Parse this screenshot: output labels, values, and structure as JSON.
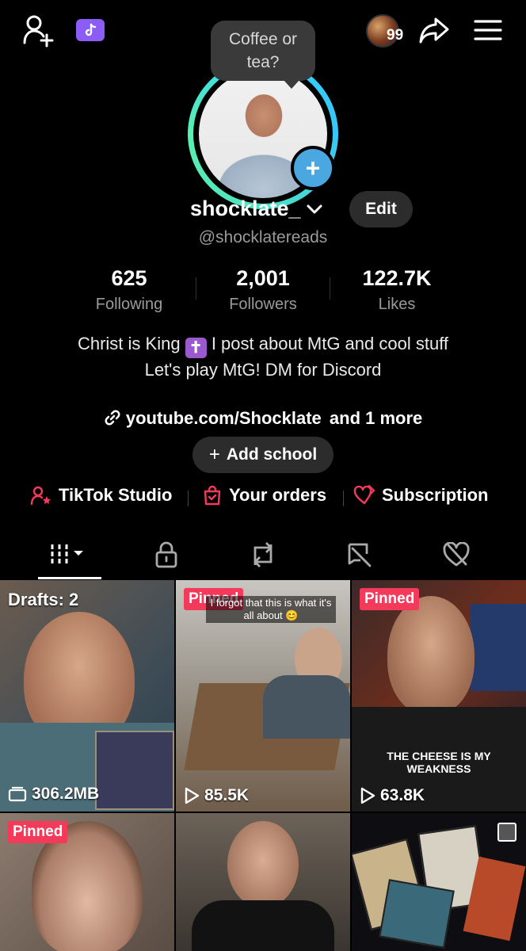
{
  "tooltip": {
    "text": "Coffee or tea?"
  },
  "header": {
    "notification_count": "99"
  },
  "profile": {
    "username": "shocklate_",
    "edit_label": "Edit",
    "handle": "@shocklatereads"
  },
  "stats": [
    {
      "value": "625",
      "label": "Following"
    },
    {
      "value": "2,001",
      "label": "Followers"
    },
    {
      "value": "122.7K",
      "label": "Likes"
    }
  ],
  "bio": {
    "line1_pre": "Christ is King",
    "line1_post": "I post about MtG and cool stuff",
    "line2": "Let's play MtG! DM for Discord"
  },
  "link": {
    "url": "youtube.com/Shocklate",
    "more": "and 1 more"
  },
  "school": {
    "label": "Add school"
  },
  "tools": [
    {
      "label": "TikTok Studio",
      "icon": "person-star-icon"
    },
    {
      "label": "Your orders",
      "icon": "bag-icon"
    },
    {
      "label": "Subscription",
      "icon": "hearts-icon"
    }
  ],
  "tabs": [
    "videos-grid-icon",
    "lock-icon",
    "repost-icon",
    "tagged-icon",
    "liked-icon"
  ],
  "grid": {
    "drafts_label": "Drafts: 2",
    "drafts_size": "306.2MB",
    "pinned_label": "Pinned",
    "overlay_caption": "I forgot that this is what it's all about 😊",
    "views": [
      "85.5K",
      "63.8K"
    ],
    "shirt_text": "THE CHEESE IS MY WEAKNESS"
  },
  "colors": {
    "accent": "#f33a5a",
    "ring": "#38c6f6",
    "badge": "#4aa7df",
    "ticket": "#8b5cf6"
  }
}
